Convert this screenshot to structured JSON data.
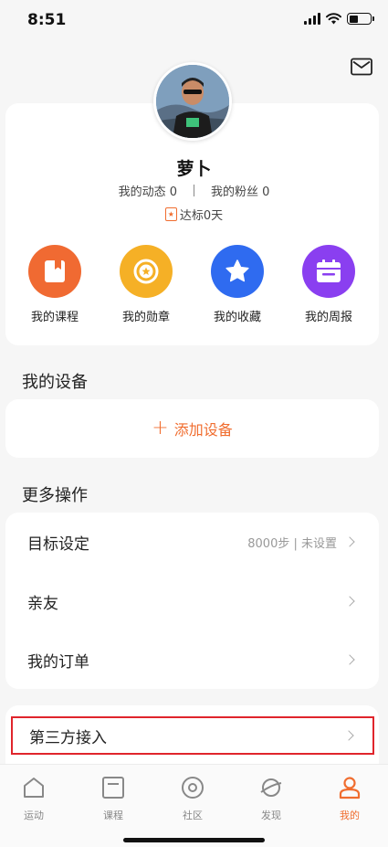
{
  "status_bar": {
    "time": "8:51"
  },
  "profile": {
    "username": "萝卜",
    "posts_label": "我的动态 0",
    "fans_label": "我的粉丝 0",
    "streak_label": "达标0天"
  },
  "quick_actions": [
    {
      "label": "我的课程",
      "icon": "course-book-icon",
      "color": "#f06a32"
    },
    {
      "label": "我的勋章",
      "icon": "medal-icon",
      "color": "#f5b026"
    },
    {
      "label": "我的收藏",
      "icon": "star-icon",
      "color": "#2f6bf0"
    },
    {
      "label": "我的周报",
      "icon": "calendar-icon",
      "color": "#8a3ff0"
    }
  ],
  "devices": {
    "title": "我的设备",
    "add_label": "添加设备"
  },
  "more": {
    "title": "更多操作",
    "rows": [
      {
        "label": "目标设定",
        "extra": "8000步 | 未设置"
      },
      {
        "label": "亲友",
        "extra": ""
      },
      {
        "label": "我的订单",
        "extra": ""
      }
    ]
  },
  "third_party": {
    "label": "第三方接入"
  },
  "tabs": [
    {
      "label": "运动",
      "icon": "home-icon",
      "active": false
    },
    {
      "label": "课程",
      "icon": "course-icon",
      "active": false
    },
    {
      "label": "社区",
      "icon": "community-icon",
      "active": false
    },
    {
      "label": "发现",
      "icon": "planet-icon",
      "active": false
    },
    {
      "label": "我的",
      "icon": "user-icon",
      "active": true
    }
  ],
  "colors": {
    "accent": "#f06d2f",
    "highlight_border": "#e0252c"
  }
}
